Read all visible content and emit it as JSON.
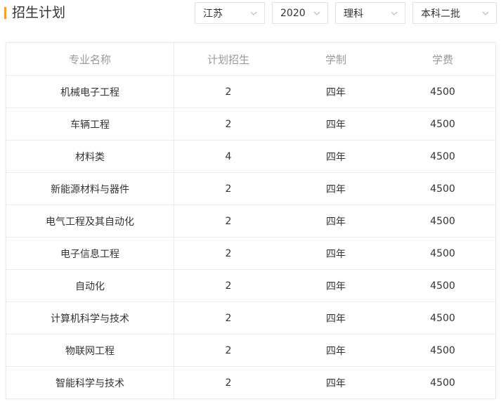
{
  "header": {
    "title": "招生计划",
    "accent_color": "#f39c34"
  },
  "filters": [
    {
      "label": "江苏"
    },
    {
      "label": "2020"
    },
    {
      "label": "理科"
    },
    {
      "label": "本科二批"
    }
  ],
  "table": {
    "columns": [
      "专业名称",
      "计划招生",
      "学制",
      "学费"
    ],
    "rows": [
      {
        "name": "机械电子工程",
        "count": "2",
        "years": "四年",
        "fee": "4500"
      },
      {
        "name": "车辆工程",
        "count": "2",
        "years": "四年",
        "fee": "4500"
      },
      {
        "name": "材料类",
        "count": "4",
        "years": "四年",
        "fee": "4500"
      },
      {
        "name": "新能源材料与器件",
        "count": "2",
        "years": "四年",
        "fee": "4500"
      },
      {
        "name": "电气工程及其自动化",
        "count": "2",
        "years": "四年",
        "fee": "4500"
      },
      {
        "name": "电子信息工程",
        "count": "2",
        "years": "四年",
        "fee": "4500"
      },
      {
        "name": "自动化",
        "count": "2",
        "years": "四年",
        "fee": "4500"
      },
      {
        "name": "计算机科学与技术",
        "count": "2",
        "years": "四年",
        "fee": "4500"
      },
      {
        "name": "物联网工程",
        "count": "2",
        "years": "四年",
        "fee": "4500"
      },
      {
        "name": "智能科学与技术",
        "count": "2",
        "years": "四年",
        "fee": "4500"
      }
    ]
  }
}
